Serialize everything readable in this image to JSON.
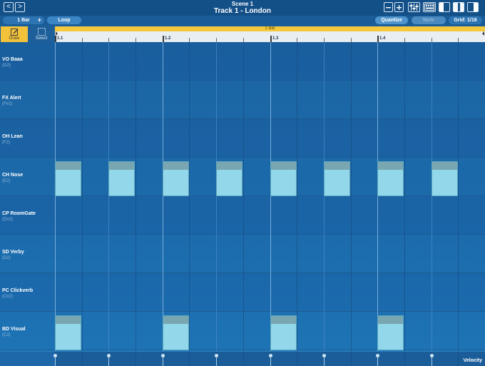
{
  "header": {
    "scene": "Scene 1",
    "track": "Track 1 - London",
    "back_glyph": "<",
    "forward_glyph": ">",
    "icons": [
      "zoom-out-icon",
      "zoom-in-icon",
      "mixer-icon",
      "keyboard-icon",
      "layout-left-icon",
      "layout-split-icon",
      "layout-right-icon"
    ]
  },
  "toolbar": {
    "length": "1 Bar",
    "length_plus": "+",
    "loop": "Loop",
    "quantize": "Quantize",
    "mute": "Mute",
    "grid": "Grid: 1/16"
  },
  "tools": {
    "draw": "Draw",
    "select": "Select"
  },
  "timeline": {
    "loop_label": "1 Bar",
    "markers": [
      "1.1",
      "1.2",
      "1.3",
      "1.4"
    ]
  },
  "lanes": [
    {
      "name": "VO Baaa",
      "pitch": "(G2)"
    },
    {
      "name": "FX Alert",
      "pitch": "(F#2)"
    },
    {
      "name": "OH Lean",
      "pitch": "(F2)"
    },
    {
      "name": "CH Nose",
      "pitch": "(E2)"
    },
    {
      "name": "CP RoomGate",
      "pitch": "(D#2)"
    },
    {
      "name": "SD Verby",
      "pitch": "(D2)"
    },
    {
      "name": "PC Clickverb",
      "pitch": "(C#2)"
    },
    {
      "name": "BD Visual",
      "pitch": "(C2)"
    }
  ],
  "notes": [
    {
      "lane": 3,
      "step": 0
    },
    {
      "lane": 3,
      "step": 2
    },
    {
      "lane": 3,
      "step": 4
    },
    {
      "lane": 3,
      "step": 6
    },
    {
      "lane": 3,
      "step": 8
    },
    {
      "lane": 3,
      "step": 10
    },
    {
      "lane": 3,
      "step": 12
    },
    {
      "lane": 3,
      "step": 14
    },
    {
      "lane": 7,
      "step": 0
    },
    {
      "lane": 7,
      "step": 4
    },
    {
      "lane": 7,
      "step": 8
    },
    {
      "lane": 7,
      "step": 12
    }
  ],
  "grid": {
    "steps": 16,
    "steps_per_beat": 4
  },
  "velocity": {
    "label": "Velocity"
  },
  "colors": {
    "accent": "#f5c93c",
    "note": "#93d8ea",
    "background": "#1b6cae"
  }
}
